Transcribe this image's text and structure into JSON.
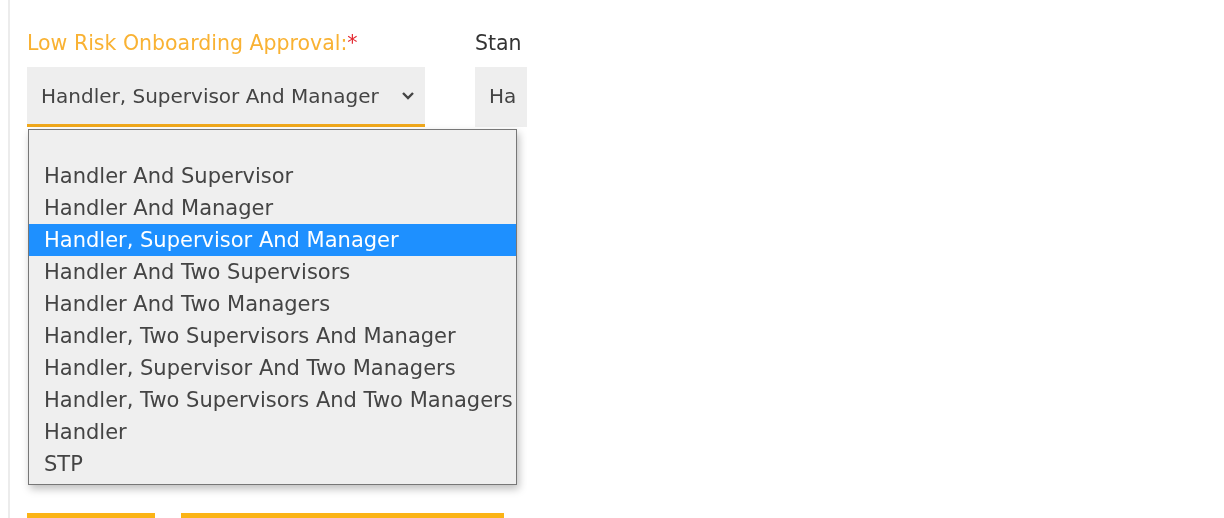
{
  "fields": [
    {
      "label": "Low Risk Onboarding Approval:",
      "required": true,
      "required_mark": "*",
      "value": "Handler, Supervisor And Manager",
      "open": true,
      "options": [
        {
          "kind": "blank"
        },
        {
          "kind": "text",
          "label": "Handler And Supervisor",
          "selected": false
        },
        {
          "kind": "text",
          "label": "Handler And Manager",
          "selected": false
        },
        {
          "kind": "text",
          "label": "Handler, Supervisor And Manager",
          "selected": true
        },
        {
          "kind": "text",
          "label": "Handler And Two Supervisors",
          "selected": false
        },
        {
          "kind": "text",
          "label": "Handler And Two Managers",
          "selected": false
        },
        {
          "kind": "text",
          "label": "Handler, Two Supervisors And Manager",
          "selected": false
        },
        {
          "kind": "text",
          "label": "Handler, Supervisor And Two Managers",
          "selected": false
        },
        {
          "kind": "text",
          "label": "Handler, Two Supervisors And Two Managers",
          "selected": false
        },
        {
          "kind": "text",
          "label": "Handler",
          "selected": false
        },
        {
          "kind": "text",
          "label": "STP",
          "selected": false
        }
      ]
    },
    {
      "label": "Stan",
      "required": false,
      "value": "Ha",
      "open": false
    }
  ]
}
